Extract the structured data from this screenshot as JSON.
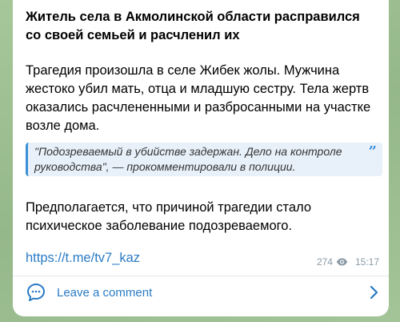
{
  "post": {
    "title": "Житель села в Акмолинской области расправился со своей семьей и расчленил их",
    "paragraph1": "Трагедия произошла в селе Жибек жолы. Мужчина жестоко убил мать, отца и младшую сестру. Тела жертв оказались расчлененными и разбросанными на участке возле дома.",
    "quote": "\"Подозреваемый в убийстве задержан. Дело на контроле руководства\", — прокомментировали в полиции.",
    "paragraph2": "Предполагается, что причиной трагедии стало психическое заболевание подозреваемого.",
    "link": "https://t.me/tv7_kaz",
    "views": "274",
    "time": "15:17"
  },
  "comments": {
    "label": "Leave a comment"
  },
  "colors": {
    "accent": "#2a7bc4",
    "quote_bar": "#3a8fd6",
    "quote_bg": "#e8f1fa",
    "meta": "#8a9aa6",
    "wallpaper": "#9fbf94"
  },
  "icons": {
    "quote": "quote-marks-icon",
    "views": "eye-icon",
    "comments": "speech-bubble-icon",
    "chevron": "chevron-right-icon"
  }
}
